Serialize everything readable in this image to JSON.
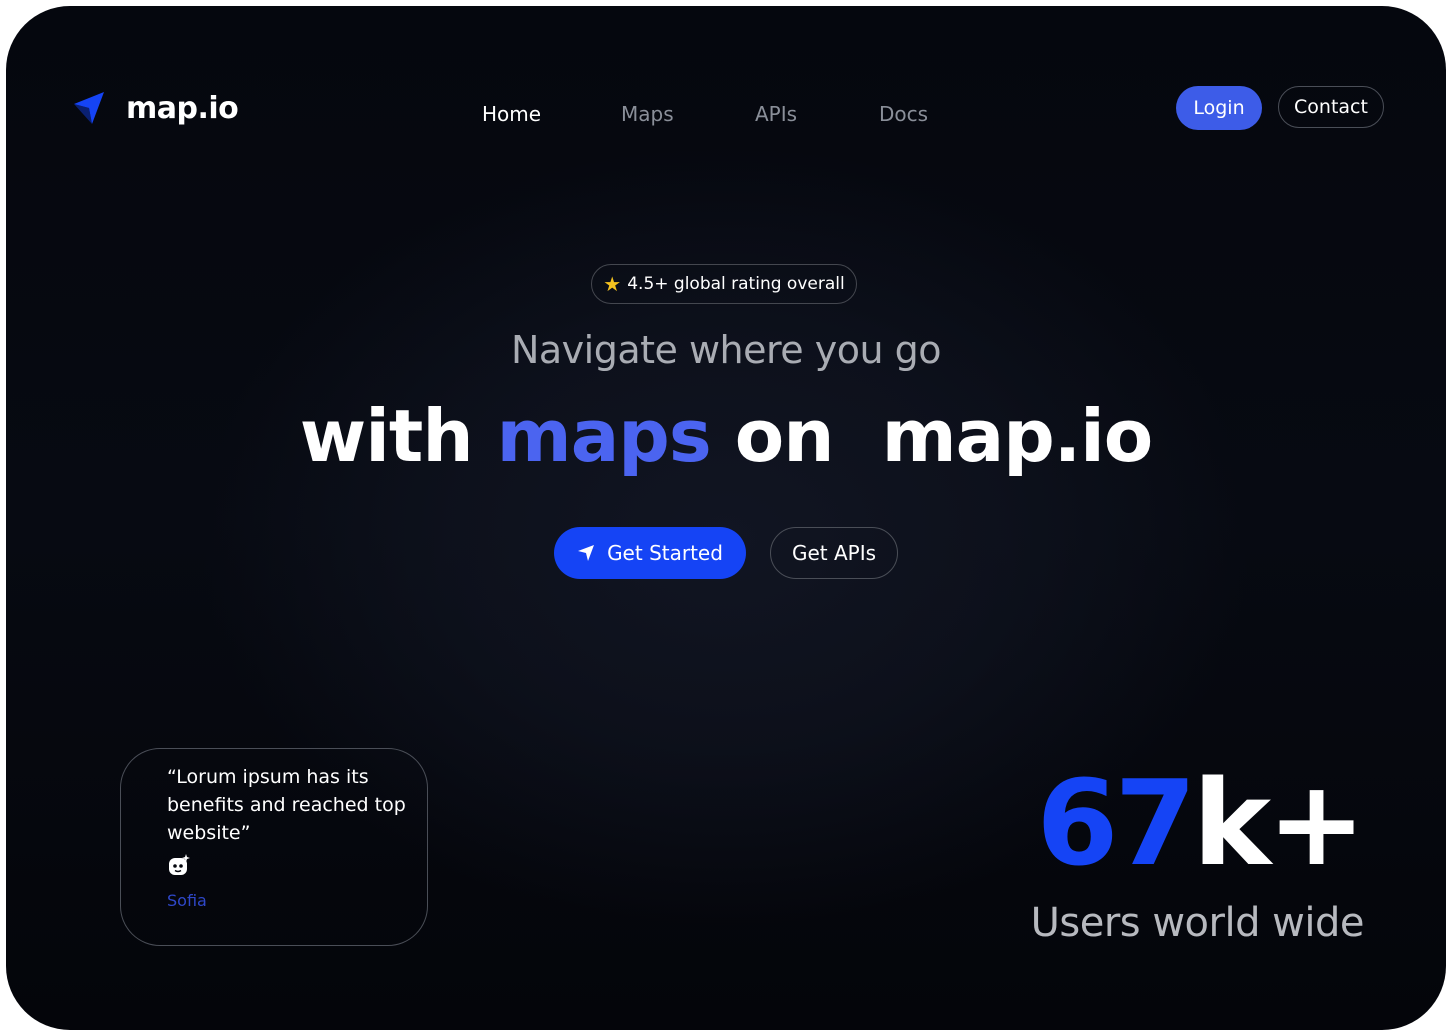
{
  "header": {
    "logo_text": "map.io",
    "nav": [
      {
        "label": "Home",
        "active": true
      },
      {
        "label": "Maps",
        "active": false
      },
      {
        "label": "APIs",
        "active": false
      },
      {
        "label": "Docs",
        "active": false
      }
    ],
    "login_label": "Login",
    "contact_label": "Contact"
  },
  "hero": {
    "rating_icon": "star-icon",
    "rating_text": "4.5+ global rating overall",
    "subtitle": "Navigate where you go",
    "headline_part1": "with",
    "headline_accent": "maps",
    "headline_part2": "on  map.io",
    "cta_primary": "Get Started",
    "cta_primary_icon": "navigation-arrow-icon",
    "cta_secondary": "Get APIs"
  },
  "testimonial": {
    "quote": "“Lorum ipsum has its benefits and reached top website”",
    "avatar_icon": "face-sparkle-icon",
    "author": "Sofia"
  },
  "stats": {
    "number_accent": "67",
    "number_suffix": "k+",
    "label": "Users world wide"
  },
  "colors": {
    "background": "#05070e",
    "accent_blue": "#1544f5",
    "login_blue": "#3d5ce8",
    "headline_accent": "#4b64f0",
    "muted_text": "#8a8f99",
    "star": "#f4c21f"
  }
}
